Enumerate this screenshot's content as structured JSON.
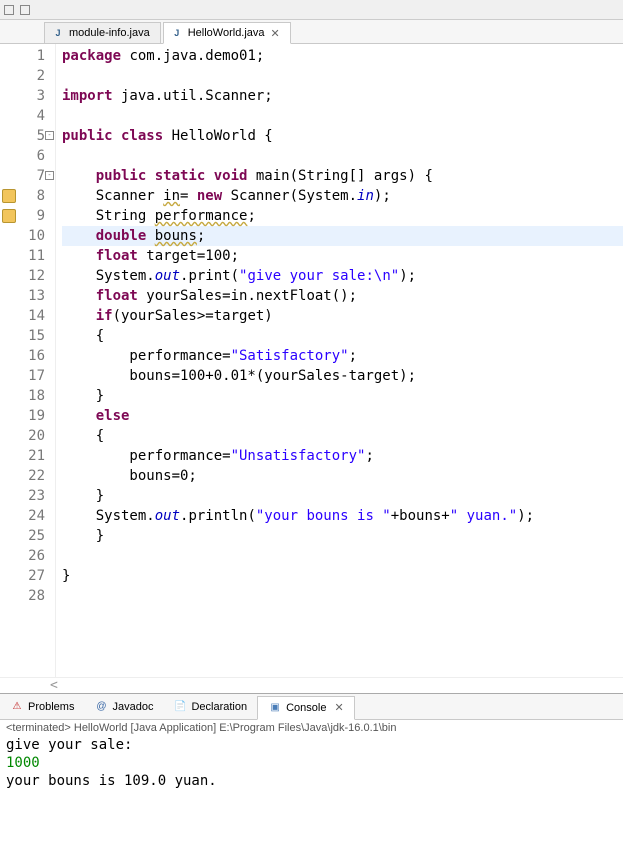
{
  "tabs": [
    {
      "label": "module-info.java",
      "active": false
    },
    {
      "label": "HelloWorld.java",
      "active": true
    }
  ],
  "lines": [
    {
      "n": 1,
      "tokens": [
        [
          "kw",
          "package"
        ],
        [
          "",
          " com.java.demo01;"
        ]
      ]
    },
    {
      "n": 2,
      "tokens": []
    },
    {
      "n": 3,
      "tokens": [
        [
          "kw",
          "import"
        ],
        [
          "",
          " java.util.Scanner;"
        ]
      ]
    },
    {
      "n": 4,
      "tokens": []
    },
    {
      "n": 5,
      "tokens": [
        [
          "kw",
          "public class"
        ],
        [
          "",
          " HelloWorld {"
        ]
      ],
      "fold": true
    },
    {
      "n": 6,
      "tokens": []
    },
    {
      "n": 7,
      "tokens": [
        [
          "",
          "    "
        ],
        [
          "kw",
          "public static void"
        ],
        [
          "",
          " main(String[] args) {"
        ]
      ],
      "fold": true
    },
    {
      "n": 8,
      "tokens": [
        [
          "",
          "    Scanner "
        ],
        [
          "warn",
          "in"
        ],
        [
          "",
          "= "
        ],
        [
          "kw",
          "new"
        ],
        [
          "",
          " Scanner(System."
        ],
        [
          "fld",
          "in"
        ],
        [
          "",
          ");"
        ]
      ],
      "marker": true
    },
    {
      "n": 9,
      "tokens": [
        [
          "",
          "    String "
        ],
        [
          "warn",
          "performance"
        ],
        [
          "",
          ";"
        ]
      ],
      "marker": true
    },
    {
      "n": 10,
      "tokens": [
        [
          "",
          "    "
        ],
        [
          "kw",
          "double"
        ],
        [
          "",
          " "
        ],
        [
          "warn",
          "bouns"
        ],
        [
          "",
          ";"
        ]
      ],
      "hl": true
    },
    {
      "n": 11,
      "tokens": [
        [
          "",
          "    "
        ],
        [
          "kw",
          "float"
        ],
        [
          "",
          " target=100;"
        ]
      ]
    },
    {
      "n": 12,
      "tokens": [
        [
          "",
          "    System."
        ],
        [
          "fld",
          "out"
        ],
        [
          "",
          ".print("
        ],
        [
          "str",
          "\"give your sale:\\n\""
        ],
        [
          "",
          ");"
        ]
      ]
    },
    {
      "n": 13,
      "tokens": [
        [
          "",
          "    "
        ],
        [
          "kw",
          "float"
        ],
        [
          "",
          " yourSales=in.nextFloat();"
        ]
      ]
    },
    {
      "n": 14,
      "tokens": [
        [
          "",
          "    "
        ],
        [
          "kw",
          "if"
        ],
        [
          "",
          "(yourSales>=target)"
        ]
      ]
    },
    {
      "n": 15,
      "tokens": [
        [
          "",
          "    {"
        ]
      ]
    },
    {
      "n": 16,
      "tokens": [
        [
          "",
          "        performance="
        ],
        [
          "str",
          "\"Satisfactory\""
        ],
        [
          "",
          ";"
        ]
      ]
    },
    {
      "n": 17,
      "tokens": [
        [
          "",
          "        bouns=100+0.01*(yourSales-target);"
        ]
      ]
    },
    {
      "n": 18,
      "tokens": [
        [
          "",
          "    }"
        ]
      ]
    },
    {
      "n": 19,
      "tokens": [
        [
          "",
          "    "
        ],
        [
          "kw",
          "else"
        ]
      ]
    },
    {
      "n": 20,
      "tokens": [
        [
          "",
          "    {"
        ]
      ]
    },
    {
      "n": 21,
      "tokens": [
        [
          "",
          "        performance="
        ],
        [
          "str",
          "\"Unsatisfactory\""
        ],
        [
          "",
          ";"
        ]
      ]
    },
    {
      "n": 22,
      "tokens": [
        [
          "",
          "        bouns=0;"
        ]
      ]
    },
    {
      "n": 23,
      "tokens": [
        [
          "",
          "    }"
        ]
      ]
    },
    {
      "n": 24,
      "tokens": [
        [
          "",
          "    System."
        ],
        [
          "fld",
          "out"
        ],
        [
          "",
          ".println("
        ],
        [
          "str",
          "\"your bouns is \""
        ],
        [
          "",
          "+bouns+"
        ],
        [
          "str",
          "\" yuan.\""
        ],
        [
          "",
          ");"
        ]
      ]
    },
    {
      "n": 25,
      "tokens": [
        [
          "",
          "    }"
        ]
      ]
    },
    {
      "n": 26,
      "tokens": []
    },
    {
      "n": 27,
      "tokens": [
        [
          "",
          "}"
        ]
      ]
    },
    {
      "n": 28,
      "tokens": []
    }
  ],
  "bottom_tabs": [
    {
      "label": "Problems",
      "icon": "⚠",
      "color": "#c02020"
    },
    {
      "label": "Javadoc",
      "icon": "@",
      "color": "#3867a6"
    },
    {
      "label": "Declaration",
      "icon": "📄",
      "color": "#c29b3f"
    },
    {
      "label": "Console",
      "icon": "▣",
      "color": "#4a7db8",
      "active": true
    }
  ],
  "console": {
    "header": "<terminated> HelloWorld [Java Application] E:\\Program Files\\Java\\jdk-16.0.1\\bin",
    "lines": [
      {
        "cls": "out",
        "text": "give your sale:"
      },
      {
        "cls": "in",
        "text": "1000"
      },
      {
        "cls": "out",
        "text": "your bouns is 109.0 yuan."
      }
    ]
  },
  "scroll_hint": "<"
}
